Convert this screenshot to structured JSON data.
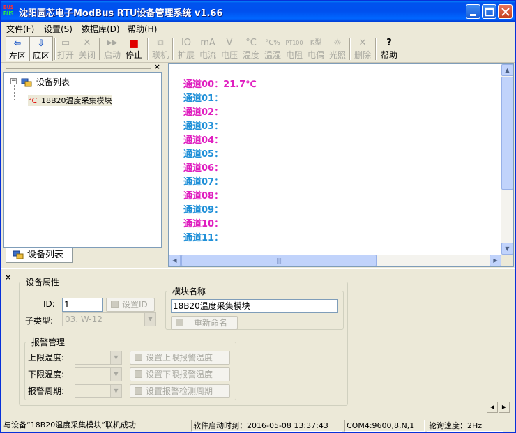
{
  "window": {
    "icon_line1": "BUS",
    "icon_line2": "BUS",
    "title": "沈阳圆芯电子ModBus RTU设备管理系统 v1.66"
  },
  "menu": [
    {
      "label": "文件(F)"
    },
    {
      "label": "设置(S)"
    },
    {
      "label": "数据库(D)"
    },
    {
      "label": "帮助(H)"
    }
  ],
  "toolbar": [
    {
      "label": "左区",
      "icon": "⇦",
      "enabled": true
    },
    {
      "label": "底区",
      "icon": "⇩",
      "enabled": true
    },
    {
      "label": "打开",
      "icon": "▭",
      "enabled": false
    },
    {
      "label": "关闭",
      "icon": "✕",
      "enabled": false
    },
    {
      "label": "启动",
      "icon": "▶▶",
      "enabled": false
    },
    {
      "label": "停止",
      "icon": "■",
      "enabled": true
    },
    {
      "label": "联机",
      "icon": "⧉",
      "enabled": false
    },
    {
      "label": "扩展",
      "icon": "IO",
      "enabled": false
    },
    {
      "label": "电流",
      "icon": "mA",
      "enabled": false
    },
    {
      "label": "电压",
      "icon": "V",
      "enabled": false
    },
    {
      "label": "温度",
      "icon": "°C",
      "enabled": false
    },
    {
      "label": "温湿",
      "icon": "°C%",
      "enabled": false
    },
    {
      "label": "电阻",
      "icon": "PT100",
      "enabled": false
    },
    {
      "label": "电偶",
      "icon": "K型",
      "enabled": false
    },
    {
      "label": "光照",
      "icon": "☼",
      "enabled": false
    },
    {
      "label": "删除",
      "icon": "✕",
      "enabled": false
    },
    {
      "label": "帮助",
      "icon": "?",
      "enabled": true
    }
  ],
  "tree": {
    "root": "设备列表",
    "child_icon": "°C",
    "child": "18B20温度采集模块",
    "tab_label": "设备列表"
  },
  "channels": [
    {
      "label": "通道00：",
      "value": "21.7℃",
      "color": "#e020c0"
    },
    {
      "label": "通道01：",
      "value": "",
      "color": "#2090d8"
    },
    {
      "label": "通道02：",
      "value": "",
      "color": "#e020c0"
    },
    {
      "label": "通道03：",
      "value": "",
      "color": "#2090d8"
    },
    {
      "label": "通道04：",
      "value": "",
      "color": "#e020c0"
    },
    {
      "label": "通道05：",
      "value": "",
      "color": "#2090d8"
    },
    {
      "label": "通道06：",
      "value": "",
      "color": "#e020c0"
    },
    {
      "label": "通道07：",
      "value": "",
      "color": "#2090d8"
    },
    {
      "label": "通道08：",
      "value": "",
      "color": "#e020c0"
    },
    {
      "label": "通道09：",
      "value": "",
      "color": "#2090d8"
    },
    {
      "label": "通道10：",
      "value": "",
      "color": "#e020c0"
    },
    {
      "label": "通道11：",
      "value": "",
      "color": "#2090d8"
    }
  ],
  "device_props": {
    "group_title": "设备属性",
    "id_label": "ID:",
    "id_value": "1",
    "set_id_button": "设置ID",
    "subtype_label": "子类型:",
    "subtype_value": "03. W-12"
  },
  "module_name": {
    "group_title": "模块名称",
    "value": "18B20温度采集模块",
    "rename_button": "重新命名"
  },
  "alarm": {
    "group_title": "报警管理",
    "upper_label": "上限温度:",
    "lower_label": "下限温度:",
    "period_label": "报警周期:",
    "set_upper_button": "设置上限报警温度",
    "set_lower_button": "设置下限报警温度",
    "set_period_button": "设置报警检测周期"
  },
  "status": {
    "message": "与设备“18B20温度采集模块”联机成功",
    "start_time": "软件启动时刻：2016-05-08 13:37:43",
    "port": "COM4:9600,8,N,1",
    "poll_rate": "轮询速度：2Hz"
  },
  "colors": {
    "title_blue": "#0053ee",
    "channel_magenta": "#e020c0",
    "channel_blue": "#2090d8",
    "stop_red": "#e00000"
  }
}
